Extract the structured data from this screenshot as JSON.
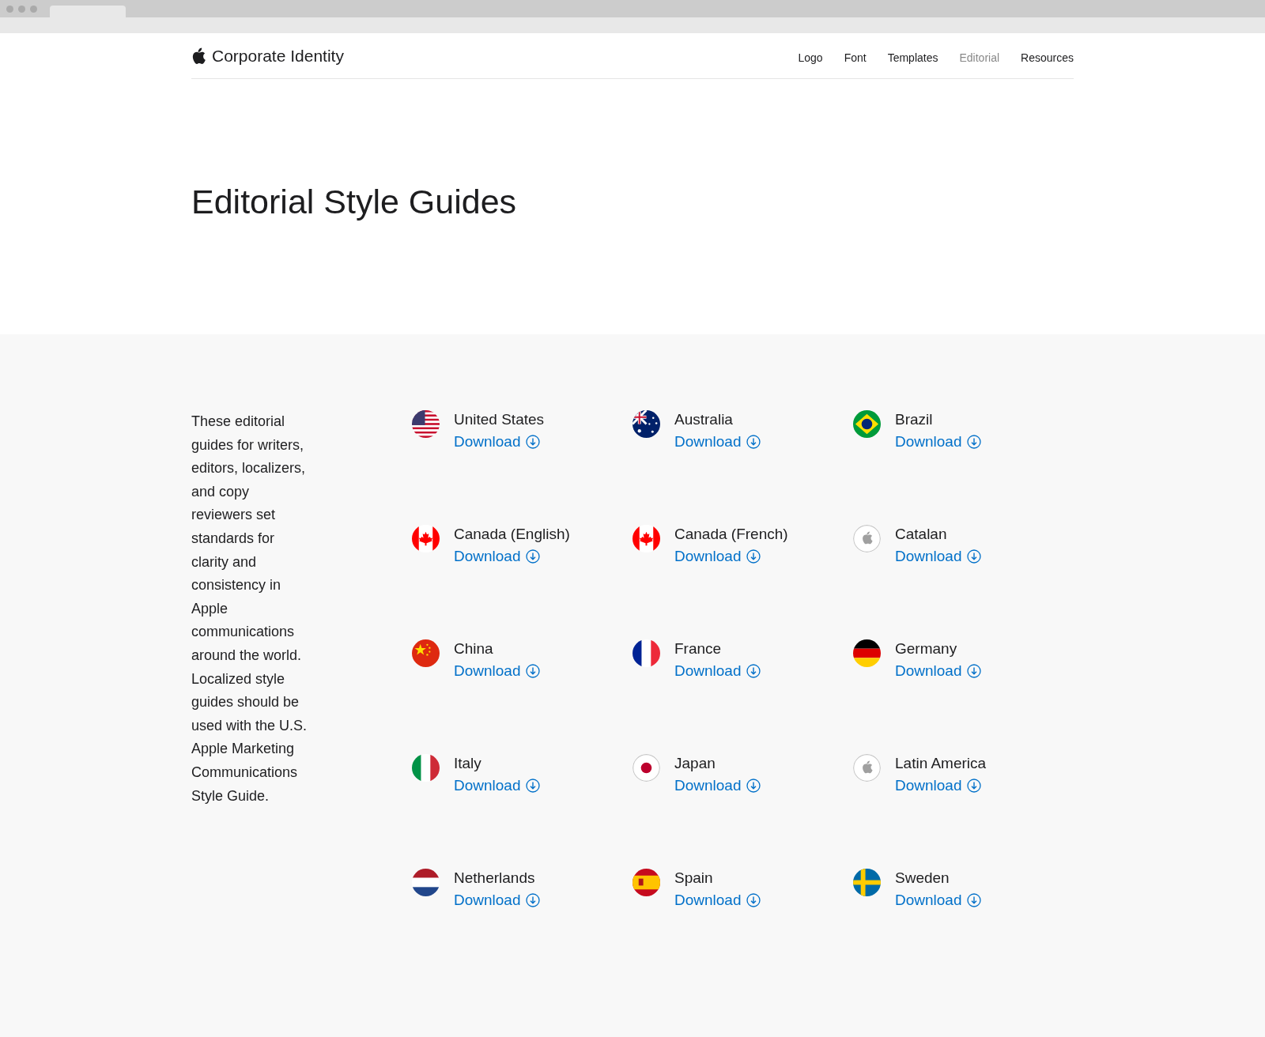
{
  "brand": {
    "title": "Corporate Identity"
  },
  "nav": [
    {
      "label": "Logo",
      "selected": false
    },
    {
      "label": "Font",
      "selected": false
    },
    {
      "label": "Templates",
      "selected": false
    },
    {
      "label": "Editorial",
      "selected": true
    },
    {
      "label": "Resources",
      "selected": false
    }
  ],
  "heading": "Editorial Style Guides",
  "intro": "These editorial guides for writers, editors, localizers, and copy reviewers set standards for clarity and consistency in Apple communications around the world. Localized style guides should be used with the U.S. Apple Marketing Communications Style Guide.",
  "guides": [
    {
      "name": "United States",
      "link": "Download",
      "kind": "us"
    },
    {
      "name": "Australia",
      "link": "Download",
      "kind": "au"
    },
    {
      "name": "Brazil",
      "link": "Download",
      "kind": "br"
    },
    {
      "name": "Canada (English)",
      "link": "Download",
      "kind": "ca"
    },
    {
      "name": "Canada (French)",
      "link": "Download",
      "kind": "ca"
    },
    {
      "name": "Catalan",
      "link": "Download",
      "kind": "apple"
    },
    {
      "name": "China",
      "link": "Download",
      "kind": "cn"
    },
    {
      "name": "France",
      "link": "Download",
      "kind": "fr"
    },
    {
      "name": "Germany",
      "link": "Download",
      "kind": "de"
    },
    {
      "name": "Italy",
      "link": "Download",
      "kind": "it"
    },
    {
      "name": "Japan",
      "link": "Download",
      "kind": "jp"
    },
    {
      "name": "Latin America",
      "link": "Download",
      "kind": "apple"
    },
    {
      "name": "Netherlands",
      "link": "Download",
      "kind": "nl"
    },
    {
      "name": "Spain",
      "link": "Download",
      "kind": "es"
    },
    {
      "name": "Sweden",
      "link": "Download",
      "kind": "se"
    }
  ]
}
